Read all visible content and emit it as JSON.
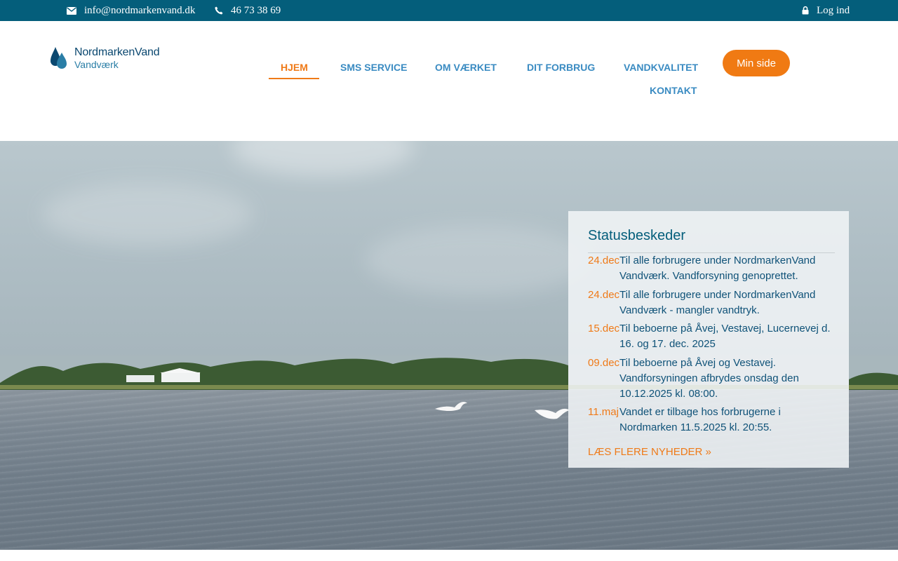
{
  "topbar": {
    "email": "info@nordmarkenvand.dk",
    "phone": "46 73 38 69",
    "login": "Log ind",
    "icons": [
      "envelope-icon",
      "phone-icon",
      "lock-icon"
    ]
  },
  "logo": {
    "line1": "NordmarkenVand",
    "line2": "Vandværk"
  },
  "nav": {
    "items": [
      {
        "label": "HJEM",
        "active": true
      },
      {
        "label": "SMS SERVICE"
      },
      {
        "label": "OM VÆRKET"
      },
      {
        "label": "DIT FORBRUG"
      },
      {
        "label": "VANDKVALITET"
      },
      {
        "label": "KONTAKT"
      }
    ],
    "cta": "Min side"
  },
  "status": {
    "title": "Statusbeskeder",
    "items": [
      {
        "date": "24.dec",
        "text": "Til alle forbrugere under NordmarkenVand Vandværk. Vandforsyning genoprettet."
      },
      {
        "date": "24.dec",
        "text": "Til alle forbrugere under NordmarkenVand Vandværk - mangler vandtryk."
      },
      {
        "date": "15.dec",
        "text": "Til beboerne på Åvej, Vestavej, Lucernevej d. 16. og 17. dec. 2025"
      },
      {
        "date": "09.dec",
        "text": "Til beboerne på Åvej og Vestavej. Vandforsyningen afbrydes onsdag den 10.12.2025 kl. 08:00."
      },
      {
        "date": "11.maj",
        "text": "Vandet er tilbage hos forbrugerne i Nordmarken 11.5.2025 kl. 20:55."
      }
    ],
    "more": "LÆS FLERE NYHEDER »"
  },
  "colors": {
    "topbar": "#045e7b",
    "accent": "#ef7a18",
    "nav": "#3a8bc2",
    "heading": "#045e7b"
  }
}
